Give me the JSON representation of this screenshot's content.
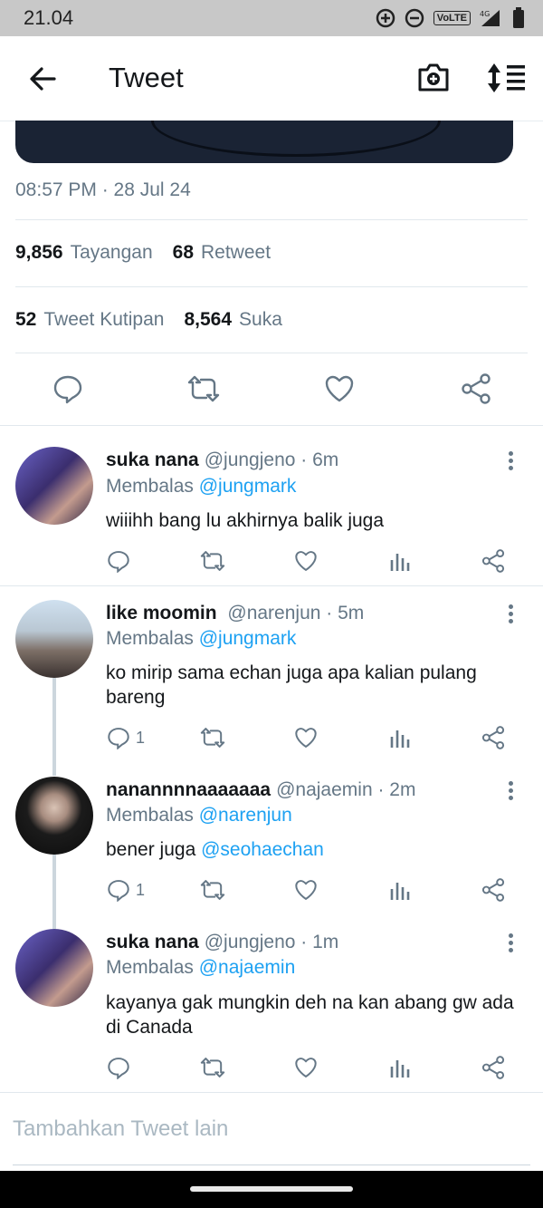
{
  "status_bar": {
    "time": "21.04",
    "network_label": "VoLTE",
    "network_type": "4G"
  },
  "app_bar": {
    "title": "Tweet"
  },
  "tweet": {
    "timestamp": "08:57 PM · 28 Jul 24",
    "views": {
      "count": "9,856",
      "label": "Tayangan"
    },
    "retweets": {
      "count": "68",
      "label": "Retweet"
    },
    "quotes": {
      "count": "52",
      "label": "Tweet Kutipan"
    },
    "likes": {
      "count": "8,564",
      "label": "Suka"
    }
  },
  "replies": [
    {
      "name": "suka nana",
      "handle": "@jungjeno",
      "time": "· 6m",
      "replying_prefix": "Membalas",
      "replying_to": "@jungmark",
      "text": "wiiihh bang lu akhirnya balik juga",
      "reply_count": ""
    },
    {
      "name": "like moomin",
      "handle": "@narenjun",
      "time": "· 5m",
      "replying_prefix": "Membalas",
      "replying_to": "@jungmark",
      "text": "ko mirip sama echan juga apa kalian pulang bareng",
      "reply_count": "1"
    },
    {
      "name": "nanannnnaaaaaaa",
      "handle": "@najaemin",
      "time": "· 2m",
      "replying_prefix": "Membalas",
      "replying_to": "@narenjun",
      "text_prefix": "bener juga",
      "text_mention": "@seohaechan",
      "reply_count": "1"
    },
    {
      "name": "suka nana",
      "handle": "@jungjeno",
      "time": "· 1m",
      "replying_prefix": "Membalas",
      "replying_to": "@najaemin",
      "text": "kayanya gak mungkin deh na kan abang gw ada di Canada",
      "reply_count": ""
    }
  ],
  "compose": {
    "placeholder": "Tambahkan Tweet lain"
  },
  "colors": {
    "accent": "#1da1f2",
    "secondary_text": "#657786",
    "icon": "#657786",
    "divider": "#e1e8ed"
  }
}
